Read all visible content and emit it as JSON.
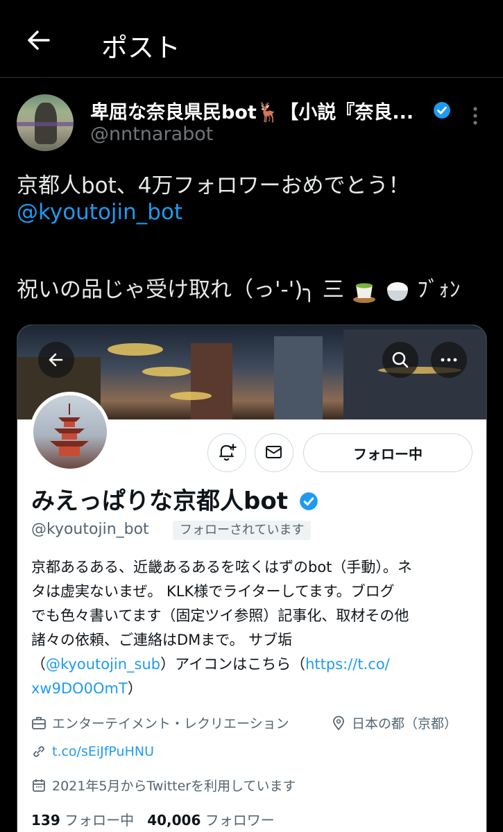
{
  "header": {
    "title": "ポスト"
  },
  "post": {
    "author_name": "卑屈な奈良県民bot🦌【小説『奈良...",
    "author_handle": "@nntnarabot",
    "line1": "京都人bot、4万フォロワーおめでとう！",
    "mention": "@kyoutojin_bot",
    "line3_text": "祝いの品じゃ受け取れ（っ'-')╮ 三",
    "line3_suffix": "ﾌﾞｫﾝ"
  },
  "profile_card": {
    "display_name": "みえっぱりな京都人bot",
    "handle": "@kyoutojin_bot",
    "follows_you_badge": "フォローされています",
    "follow_button": "フォロー中",
    "bio": {
      "l1": "京都あるある、近畿あるあるを呟くはずのbot（手動）。ネ",
      "l2": "タは虚実ないまぜ。 KLK様でライターしてます。ブログ",
      "l3": "でも色々書いてます（固定ツイ参照）記事化、取材その他",
      "l4": "諸々の依頼、ご連絡はDMまで。 サブ垢",
      "l5_open": "（",
      "l5_link": "@kyoutojin_sub",
      "l5_mid": "）アイコンはこちら（",
      "l5_url": "https://t.co/",
      "l6_url": "xw9DO0OmT",
      "l6_close": "）"
    },
    "category": "エンターテイメント・レクリエーション",
    "location": "日本の都（京都）",
    "website": "t.co/sEiJfPuHNU",
    "joined": "2021年5月からTwitterを利用しています",
    "following_count": "139",
    "following_label": "フォロー中",
    "followers_count": "40,006",
    "followers_label": "フォロワー"
  },
  "icons": [
    "back-arrow-icon",
    "verified-badge-icon",
    "more-vertical-icon",
    "notification-bell-plus-icon",
    "mail-icon",
    "search-icon",
    "more-horizontal-icon",
    "briefcase-icon",
    "location-pin-icon",
    "link-icon",
    "calendar-icon"
  ],
  "colors": {
    "background": "#000000",
    "link": "#1d9bf0",
    "verified": "#1d9bf0",
    "muted": "#71767b"
  }
}
